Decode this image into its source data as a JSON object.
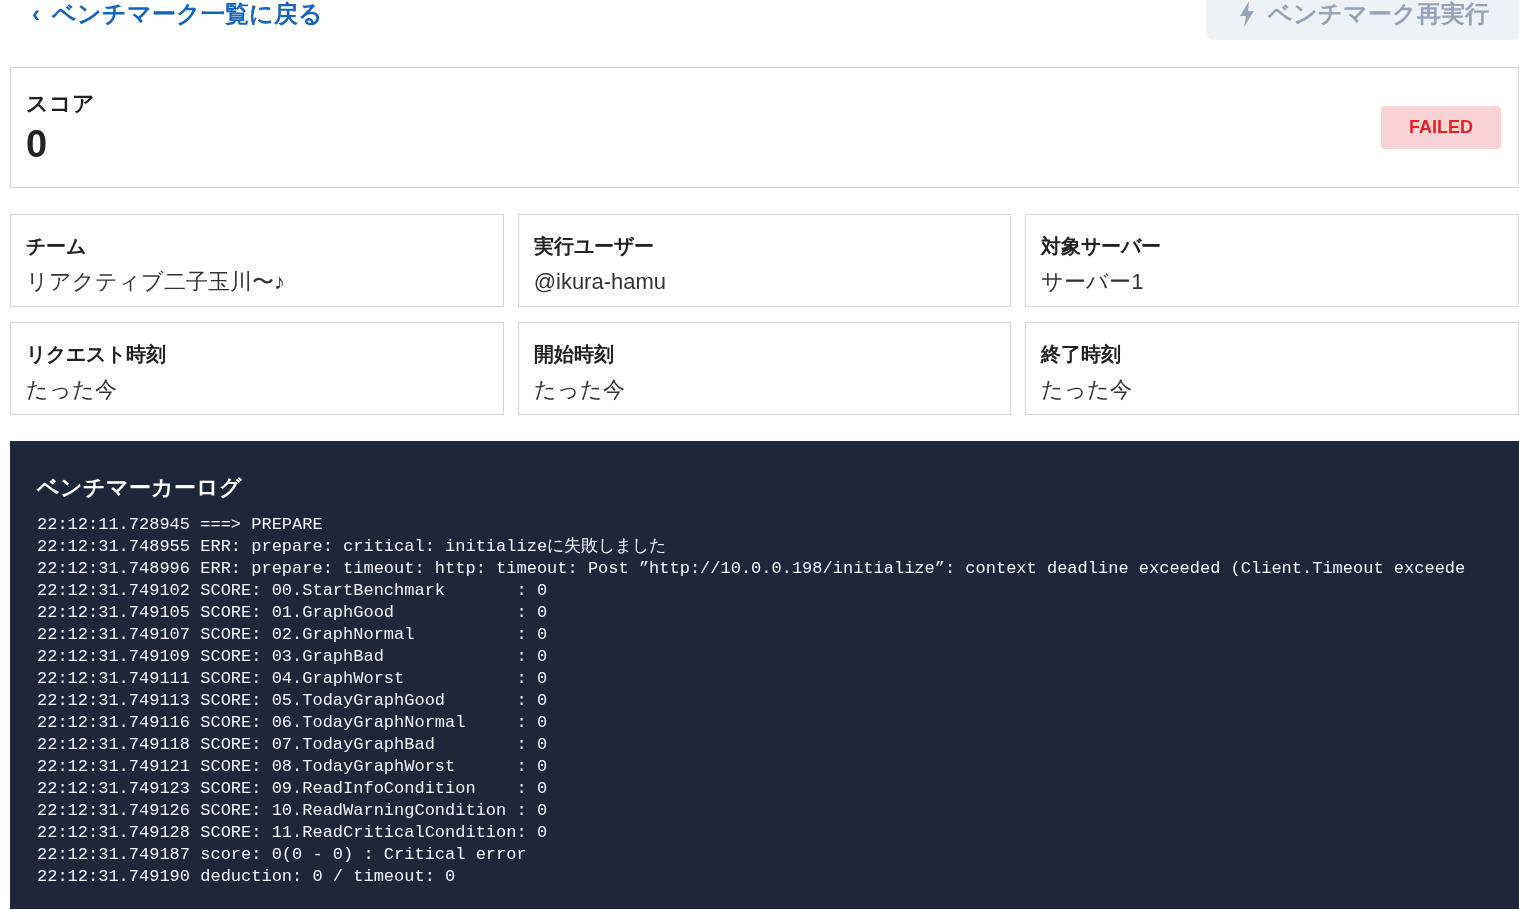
{
  "back_link": {
    "icon": "‹",
    "label": "ベンチマーク一覧に戻る"
  },
  "rerun_button": {
    "label": "ベンチマーク再実行",
    "disabled": true
  },
  "score": {
    "label": "スコア",
    "value": "0",
    "status": "FAILED"
  },
  "info": [
    {
      "label": "チーム",
      "value": "リアクティブ二子玉川〜♪"
    },
    {
      "label": "実行ユーザー",
      "value": "@ikura-hamu"
    },
    {
      "label": "対象サーバー",
      "value": "サーバー1"
    },
    {
      "label": "リクエスト時刻",
      "value": "たった今"
    },
    {
      "label": "開始時刻",
      "value": "たった今"
    },
    {
      "label": "終了時刻",
      "value": "たった今"
    }
  ],
  "log": {
    "title": "ベンチマーカーログ",
    "lines": [
      "22:12:11.728945 ===> PREPARE",
      "22:12:31.748955 ERR: prepare: critical: initializeに失敗しました",
      "22:12:31.748996 ERR: prepare: timeout: http: timeout: Post ”http://10.0.0.198/initialize”: context deadline exceeded (Client.Timeout exceede",
      "22:12:31.749102 SCORE: 00.StartBenchmark       : 0",
      "22:12:31.749105 SCORE: 01.GraphGood            : 0",
      "22:12:31.749107 SCORE: 02.GraphNormal          : 0",
      "22:12:31.749109 SCORE: 03.GraphBad             : 0",
      "22:12:31.749111 SCORE: 04.GraphWorst           : 0",
      "22:12:31.749113 SCORE: 05.TodayGraphGood       : 0",
      "22:12:31.749116 SCORE: 06.TodayGraphNormal     : 0",
      "22:12:31.749118 SCORE: 07.TodayGraphBad        : 0",
      "22:12:31.749121 SCORE: 08.TodayGraphWorst      : 0",
      "22:12:31.749123 SCORE: 09.ReadInfoCondition    : 0",
      "22:12:31.749126 SCORE: 10.ReadWarningCondition : 0",
      "22:12:31.749128 SCORE: 11.ReadCriticalCondition: 0",
      "22:12:31.749187 score: 0(0 - 0) : Critical error",
      "22:12:31.749190 deduction: 0 / timeout: 0"
    ]
  }
}
